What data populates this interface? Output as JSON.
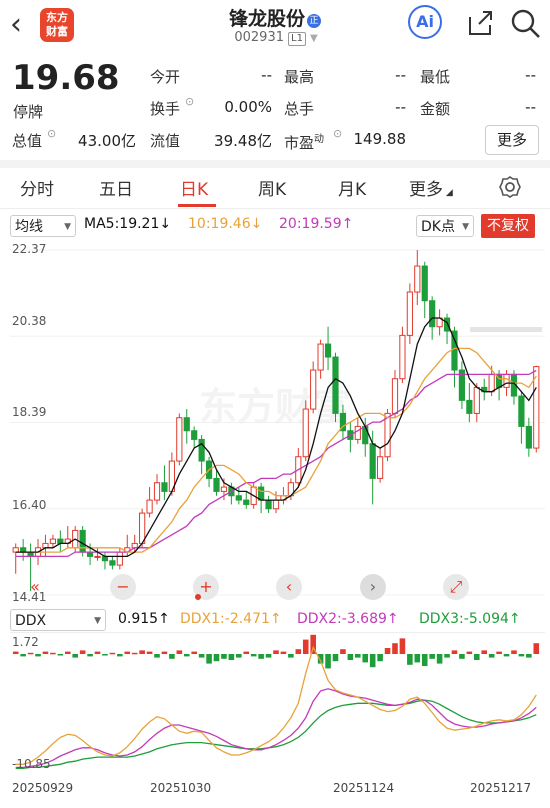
{
  "header": {
    "back_icon": "chevron-left-icon",
    "logo_text": [
      "东方",
      "财富"
    ],
    "stock_name": "锋龙股份",
    "name_badge": "正",
    "stock_code": "002931",
    "level_badge": "L1",
    "ai_label": "Ai",
    "share_icon": "share-icon",
    "search_icon": "search-icon"
  },
  "quote": {
    "price": "19.68",
    "status": "停牌",
    "rows": [
      [
        {
          "label": "今开",
          "value": "--"
        },
        {
          "label": "最高",
          "value": "--"
        },
        {
          "label": "最低",
          "value": "--"
        }
      ],
      [
        {
          "label": "换手",
          "value": "0.00%"
        },
        {
          "label": "总手",
          "value": "--"
        },
        {
          "label": "金额",
          "value": "--"
        }
      ],
      [
        {
          "label": "总值",
          "value": "43.00亿"
        },
        {
          "label": "流值",
          "value": "39.48亿"
        },
        {
          "label": "市盈",
          "sup": "动",
          "value": "149.88"
        }
      ]
    ],
    "more": "更多"
  },
  "tabs": [
    "分时",
    "五日",
    "日K",
    "周K",
    "月K",
    "更多"
  ],
  "active_tab": "日K",
  "ma_bar": {
    "select": "均线",
    "ma5": "MA5:19.21↓",
    "ma10": "10:19.46↓",
    "ma20": "20:19.59↑",
    "dk": "DK点",
    "fq": "不复权"
  },
  "colors": {
    "up": "#e23a2c",
    "down": "#1e9e3a",
    "ma5": "#111111",
    "ma10": "#e8a23a",
    "ma20": "#c23ab8",
    "ddx": "#e8a23a",
    "ddx2": "#c23ab8",
    "ddx3": "#1e9e3a"
  },
  "watermark": "东方财富",
  "controls": [
    "«",
    "−",
    "+",
    "‹",
    "›",
    "⤢"
  ],
  "ddx_bar": {
    "select": "DDX",
    "ddx": "0.915↑",
    "ddx1": "DDX1:-2.471↑",
    "ddx2": "DDX2:-3.689↑",
    "ddx3": "DDX3:-5.094↑"
  },
  "chart_data": {
    "type": "candlestick",
    "y_ticks": [
      "22.37",
      "20.38",
      "18.39",
      "16.40",
      "14.41"
    ],
    "ylim": [
      14.41,
      22.37
    ],
    "x_labels": [
      "20250929",
      "20251030",
      "20251124",
      "20251217"
    ],
    "candles": [
      [
        15.4,
        15.5,
        14.9,
        15.6
      ],
      [
        15.5,
        15.4,
        15.2,
        15.7
      ],
      [
        15.4,
        15.3,
        14.5,
        15.6
      ],
      [
        15.3,
        15.5,
        15.1,
        15.7
      ],
      [
        15.5,
        15.6,
        15.3,
        15.8
      ],
      [
        15.6,
        15.7,
        15.5,
        15.8
      ],
      [
        15.7,
        15.6,
        15.4,
        15.9
      ],
      [
        15.6,
        15.7,
        15.5,
        16.0
      ],
      [
        15.5,
        15.9,
        15.4,
        16.0
      ],
      [
        15.9,
        15.4,
        15.3,
        16.0
      ],
      [
        15.4,
        15.3,
        15.1,
        15.6
      ],
      [
        15.3,
        15.3,
        15.2,
        15.5
      ],
      [
        15.3,
        15.2,
        15.0,
        15.4
      ],
      [
        15.2,
        15.1,
        15.0,
        15.3
      ],
      [
        15.1,
        15.4,
        15.0,
        15.5
      ],
      [
        15.4,
        15.5,
        15.3,
        15.8
      ],
      [
        15.5,
        15.6,
        15.4,
        15.8
      ],
      [
        15.6,
        16.3,
        15.5,
        16.4
      ],
      [
        16.3,
        16.6,
        16.2,
        16.9
      ],
      [
        16.6,
        17.0,
        16.5,
        17.2
      ],
      [
        17.0,
        16.8,
        16.6,
        17.4
      ],
      [
        16.8,
        17.5,
        16.7,
        17.7
      ],
      [
        17.5,
        18.5,
        17.4,
        18.6
      ],
      [
        18.5,
        18.2,
        17.9,
        18.7
      ],
      [
        18.2,
        18.0,
        17.8,
        18.3
      ],
      [
        18.0,
        17.5,
        17.2,
        18.1
      ],
      [
        17.5,
        17.1,
        16.9,
        17.6
      ],
      [
        17.1,
        16.8,
        16.7,
        17.3
      ],
      [
        16.8,
        16.9,
        16.6,
        17.1
      ],
      [
        16.9,
        16.7,
        16.5,
        17.0
      ],
      [
        16.7,
        16.6,
        16.5,
        16.9
      ],
      [
        16.6,
        16.5,
        16.4,
        16.8
      ],
      [
        16.5,
        16.9,
        16.4,
        17.0
      ],
      [
        16.9,
        16.6,
        16.3,
        17.0
      ],
      [
        16.6,
        16.4,
        16.3,
        16.7
      ],
      [
        16.4,
        16.6,
        16.3,
        16.8
      ],
      [
        16.6,
        16.7,
        16.5,
        16.9
      ],
      [
        16.7,
        17.0,
        16.6,
        17.1
      ],
      [
        17.0,
        17.6,
        16.9,
        17.8
      ],
      [
        17.6,
        18.7,
        17.5,
        18.9
      ],
      [
        18.7,
        19.6,
        18.6,
        19.8
      ],
      [
        19.6,
        20.2,
        19.4,
        20.3
      ],
      [
        20.2,
        19.9,
        19.6,
        20.6
      ],
      [
        19.9,
        18.6,
        18.4,
        20.0
      ],
      [
        18.6,
        18.2,
        18.0,
        18.8
      ],
      [
        18.2,
        18.0,
        17.7,
        18.4
      ],
      [
        18.0,
        18.3,
        17.9,
        18.5
      ],
      [
        18.3,
        17.9,
        17.6,
        18.5
      ],
      [
        17.9,
        17.1,
        16.5,
        18.2
      ],
      [
        17.1,
        17.6,
        17.0,
        17.8
      ],
      [
        17.6,
        18.6,
        17.5,
        18.7
      ],
      [
        18.6,
        19.4,
        18.5,
        19.6
      ],
      [
        19.4,
        20.4,
        19.3,
        20.6
      ],
      [
        20.4,
        21.4,
        20.2,
        21.6
      ],
      [
        21.4,
        22.0,
        21.1,
        22.37
      ],
      [
        22.0,
        21.2,
        20.8,
        22.1
      ],
      [
        21.2,
        20.6,
        20.3,
        21.3
      ],
      [
        20.6,
        20.8,
        20.4,
        21.0
      ],
      [
        20.8,
        20.5,
        20.2,
        20.9
      ],
      [
        20.5,
        19.6,
        19.2,
        20.6
      ],
      [
        19.6,
        18.9,
        18.7,
        19.8
      ],
      [
        18.9,
        18.6,
        18.4,
        19.3
      ],
      [
        18.6,
        19.2,
        18.4,
        19.3
      ],
      [
        19.2,
        19.1,
        18.9,
        19.4
      ],
      [
        19.1,
        19.5,
        19.0,
        19.7
      ],
      [
        19.5,
        19.2,
        18.9,
        19.6
      ],
      [
        19.2,
        19.5,
        19.0,
        19.6
      ],
      [
        19.5,
        19.0,
        18.8,
        19.6
      ],
      [
        19.0,
        18.3,
        17.9,
        19.1
      ],
      [
        18.3,
        17.8,
        17.6,
        18.5
      ],
      [
        17.8,
        19.68,
        17.7,
        19.7
      ]
    ],
    "ma5": [
      15.4,
      15.4,
      15.4,
      15.4,
      15.5,
      15.5,
      15.6,
      15.6,
      15.7,
      15.6,
      15.5,
      15.4,
      15.3,
      15.3,
      15.3,
      15.3,
      15.4,
      15.6,
      15.9,
      16.2,
      16.5,
      16.8,
      17.2,
      17.5,
      17.8,
      17.9,
      17.7,
      17.3,
      17.0,
      16.9,
      16.8,
      16.8,
      16.7,
      16.6,
      16.6,
      16.6,
      16.6,
      16.7,
      16.9,
      17.3,
      17.9,
      18.6,
      19.2,
      19.4,
      19.3,
      19.0,
      18.6,
      18.3,
      17.9,
      17.8,
      17.9,
      18.2,
      18.6,
      19.4,
      20.2,
      20.6,
      20.8,
      20.8,
      20.7,
      20.3,
      19.9,
      19.4,
      19.2,
      19.1,
      19.1,
      19.2,
      19.3,
      19.3,
      19.1,
      18.9,
      19.2
    ],
    "ma10": [
      15.4,
      15.4,
      15.4,
      15.4,
      15.4,
      15.4,
      15.4,
      15.5,
      15.5,
      15.5,
      15.5,
      15.5,
      15.5,
      15.5,
      15.5,
      15.4,
      15.4,
      15.4,
      15.5,
      15.7,
      15.9,
      16.1,
      16.4,
      16.6,
      16.9,
      17.1,
      17.3,
      17.4,
      17.4,
      17.3,
      17.2,
      17.0,
      16.9,
      16.8,
      16.8,
      16.7,
      16.7,
      16.7,
      16.8,
      16.9,
      17.2,
      17.5,
      17.9,
      18.1,
      18.3,
      18.4,
      18.5,
      18.6,
      18.6,
      18.6,
      18.5,
      18.5,
      18.6,
      18.8,
      19.1,
      19.4,
      19.6,
      19.8,
      20.0,
      20.1,
      20.1,
      20.1,
      20.0,
      19.8,
      19.6,
      19.4,
      19.4,
      19.3,
      19.3,
      19.2,
      19.46
    ],
    "ma20": [
      15.3,
      15.3,
      15.3,
      15.3,
      15.3,
      15.3,
      15.3,
      15.3,
      15.4,
      15.4,
      15.4,
      15.4,
      15.4,
      15.4,
      15.4,
      15.4,
      15.5,
      15.5,
      15.5,
      15.6,
      15.7,
      15.8,
      15.9,
      16.0,
      16.2,
      16.3,
      16.5,
      16.6,
      16.7,
      16.8,
      16.9,
      17.0,
      17.0,
      17.1,
      17.1,
      17.1,
      17.2,
      17.2,
      17.3,
      17.4,
      17.5,
      17.6,
      17.8,
      17.9,
      18.0,
      18.1,
      18.2,
      18.3,
      18.4,
      18.4,
      18.5,
      18.6,
      18.7,
      18.9,
      19.0,
      19.2,
      19.3,
      19.4,
      19.5,
      19.5,
      19.5,
      19.5,
      19.5,
      19.5,
      19.5,
      19.5,
      19.5,
      19.5,
      19.5,
      19.5,
      19.59
    ],
    "ddx_ticks": [
      "1.72",
      "-10.85"
    ],
    "ddx_ylim": [
      -10.85,
      1.72
    ],
    "ddx_bars": [
      0.2,
      -0.2,
      0.1,
      -0.2,
      0.2,
      0.1,
      -0.1,
      0.2,
      -0.3,
      0.3,
      -0.2,
      0.2,
      -0.1,
      0.1,
      -0.2,
      0.2,
      0.1,
      0.3,
      0.2,
      -0.3,
      0.2,
      -0.4,
      0.3,
      -0.2,
      0.2,
      -0.3,
      -0.8,
      -0.6,
      -0.4,
      -0.5,
      -0.3,
      0.2,
      -0.2,
      -0.4,
      -0.3,
      0.3,
      0.2,
      -0.3,
      0.4,
      1.2,
      1.6,
      -0.8,
      -1.2,
      -0.6,
      0.4,
      -0.5,
      -0.3,
      -0.7,
      -1.1,
      -0.6,
      0.5,
      0.9,
      1.3,
      -0.9,
      -0.7,
      -1.0,
      -0.4,
      -0.8,
      -0.3,
      0.3,
      -0.4,
      0.2,
      -0.5,
      0.3,
      -0.3,
      0.2,
      -0.2,
      0.3,
      -0.2,
      -0.3,
      0.9
    ],
    "ddx1": [
      -10.3,
      -10.3,
      -10.1,
      -9.6,
      -9.0,
      -8.3,
      -7.7,
      -7.4,
      -7.5,
      -8.0,
      -8.6,
      -9.1,
      -9.4,
      -9.5,
      -9.2,
      -8.6,
      -7.8,
      -6.9,
      -6.2,
      -5.7,
      -5.9,
      -6.5,
      -7.1,
      -7.3,
      -7.1,
      -7.2,
      -8.0,
      -8.7,
      -9.1,
      -9.4,
      -9.4,
      -9.2,
      -8.9,
      -8.5,
      -8.1,
      -7.6,
      -6.8,
      -5.8,
      -4.4,
      -1.5,
      1.0,
      -0.3,
      -2.2,
      -3.1,
      -3.4,
      -3.6,
      -3.8,
      -4.2,
      -4.6,
      -5.0,
      -5.2,
      -5.1,
      -4.7,
      -4.0,
      -3.8,
      -4.4,
      -5.3,
      -6.2,
      -6.8,
      -7.0,
      -6.9,
      -6.8,
      -6.6,
      -6.3,
      -6.1,
      -6.0,
      -6.1,
      -6.0,
      -5.5,
      -4.7,
      -3.6
    ],
    "ddx2": [
      -10.6,
      -10.6,
      -10.5,
      -10.4,
      -10.2,
      -9.9,
      -9.5,
      -9.2,
      -8.9,
      -8.7,
      -8.7,
      -8.9,
      -9.2,
      -9.4,
      -9.5,
      -9.4,
      -9.1,
      -8.6,
      -7.9,
      -7.3,
      -6.8,
      -6.5,
      -6.5,
      -6.7,
      -6.9,
      -7.1,
      -7.3,
      -7.6,
      -8.0,
      -8.4,
      -8.6,
      -8.8,
      -8.9,
      -8.9,
      -8.7,
      -8.4,
      -8.0,
      -7.5,
      -6.8,
      -5.8,
      -4.2,
      -3.2,
      -3.0,
      -3.2,
      -3.5,
      -3.7,
      -3.8,
      -3.9,
      -4.1,
      -4.3,
      -4.5,
      -4.6,
      -4.5,
      -4.3,
      -4.0,
      -4.1,
      -4.6,
      -5.3,
      -6.0,
      -6.4,
      -6.6,
      -6.7,
      -6.7,
      -6.6,
      -6.4,
      -6.3,
      -6.2,
      -6.1,
      -5.8,
      -5.4,
      -4.8
    ],
    "ddx3": [
      -10.7,
      -10.7,
      -10.6,
      -10.6,
      -10.5,
      -10.4,
      -10.3,
      -10.1,
      -10.0,
      -9.8,
      -9.7,
      -9.6,
      -9.6,
      -9.6,
      -9.6,
      -9.6,
      -9.5,
      -9.3,
      -9.1,
      -8.8,
      -8.6,
      -8.4,
      -8.3,
      -8.2,
      -8.2,
      -8.2,
      -8.3,
      -8.4,
      -8.5,
      -8.6,
      -8.7,
      -8.8,
      -8.8,
      -8.8,
      -8.7,
      -8.6,
      -8.4,
      -8.1,
      -7.7,
      -7.1,
      -6.3,
      -5.6,
      -5.1,
      -4.8,
      -4.6,
      -4.5,
      -4.4,
      -4.4,
      -4.4,
      -4.5,
      -4.6,
      -4.6,
      -4.5,
      -4.4,
      -4.2,
      -4.1,
      -4.2,
      -4.5,
      -4.9,
      -5.3,
      -5.7,
      -6.0,
      -6.2,
      -6.3,
      -6.3,
      -6.3,
      -6.2,
      -6.1,
      -6.0,
      -5.8,
      -5.5
    ]
  }
}
